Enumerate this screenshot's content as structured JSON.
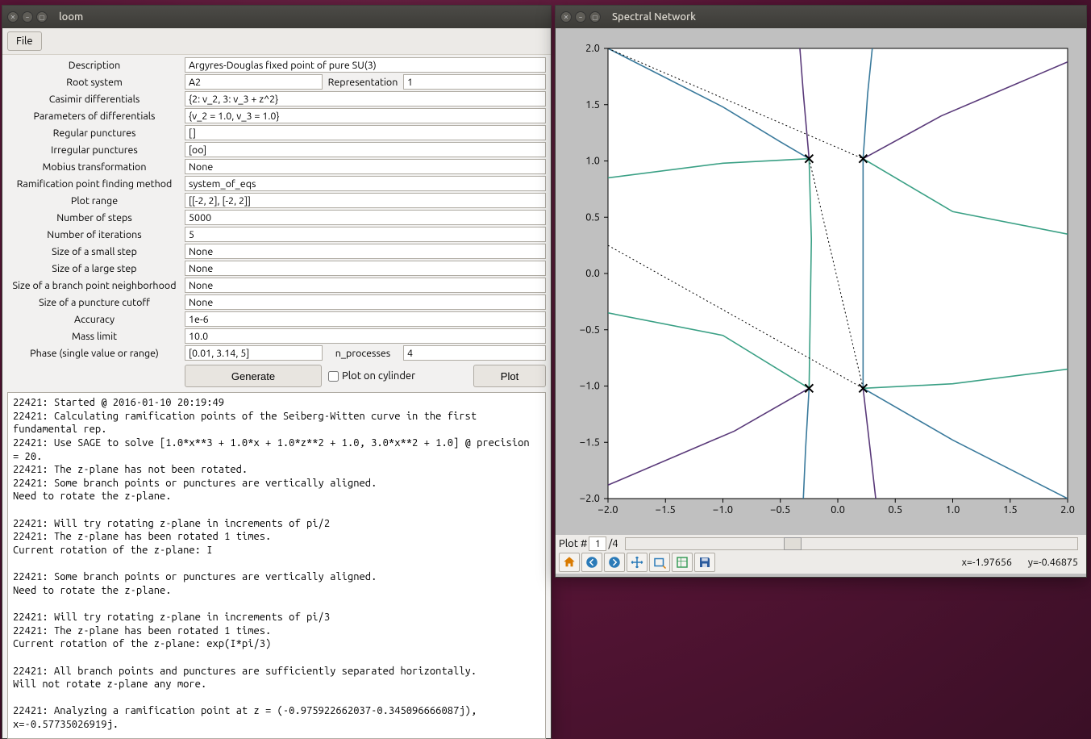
{
  "loom": {
    "title": "loom",
    "menu_file": "File",
    "labels": {
      "description": "Description",
      "root_system": "Root system",
      "representation": "Representation",
      "casimir": "Casimir differentials",
      "params_diff": "Parameters of differentials",
      "regular_punc": "Regular punctures",
      "irregular_punc": "Irregular punctures",
      "mobius": "Mobius transformation",
      "ram_method": "Ramification point finding method",
      "plot_range": "Plot range",
      "num_steps": "Number of steps",
      "num_iter": "Number of iterations",
      "small_step": "Size of a small step",
      "large_step": "Size of a large step",
      "branch_nb": "Size of a branch point neighborhood",
      "punc_cutoff": "Size of a puncture cutoff",
      "accuracy": "Accuracy",
      "mass_limit": "Mass limit",
      "phase": "Phase (single value or range)",
      "n_processes": "n_processes"
    },
    "values": {
      "description": "Argyres-Douglas fixed point of pure SU(3)",
      "root_system": "A2",
      "representation": "1",
      "casimir": "{2: v_2, 3: v_3 + z^2}",
      "params_diff": "{v_2 = 1.0, v_3 = 1.0}",
      "regular_punc": "[]",
      "irregular_punc": "[oo]",
      "mobius": "None",
      "ram_method": "system_of_eqs",
      "plot_range": "[[-2, 2], [-2, 2]]",
      "num_steps": "5000",
      "num_iter": "5",
      "small_step": "None",
      "large_step": "None",
      "branch_nb": "None",
      "punc_cutoff": "None",
      "accuracy": "1e-6",
      "mass_limit": "10.0",
      "phase": "[0.01, 3.14, 5]",
      "n_processes": "4"
    },
    "buttons": {
      "generate": "Generate",
      "plot_cyl": "Plot on cylinder",
      "plot": "Plot"
    },
    "log": "22421: Started @ 2016-01-10 20:19:49\n22421: Calculating ramification points of the Seiberg-Witten curve in the first fundamental rep.\n22421: Use SAGE to solve [1.0*x**3 + 1.0*x + 1.0*z**2 + 1.0, 3.0*x**2 + 1.0] @ precision = 20.\n22421: The z-plane has not been rotated.\n22421: Some branch points or punctures are vertically aligned.\nNeed to rotate the z-plane.\n\n22421: Will try rotating z-plane in increments of pi/2\n22421: The z-plane has been rotated 1 times.\nCurrent rotation of the z-plane: I\n\n22421: Some branch points or punctures are vertically aligned.\nNeed to rotate the z-plane.\n\n22421: Will try rotating z-plane in increments of pi/3\n22421: The z-plane has been rotated 1 times.\nCurrent rotation of the z-plane: exp(I*pi/3)\n\n22421: All branch points and punctures are sufficiently separated horizontally.\nWill not rotate z-plane any more.\n\n22421: Analyzing a ramification point at z = (-0.975922662037-0.345096666087j), x=-0.57735026919j."
  },
  "spectral": {
    "title": "Spectral Network",
    "plot_num_label": "Plot #",
    "plot_num": "1",
    "plot_total": "/4",
    "coords_x": "x=-1.97656",
    "coords_y": "y=-0.46875"
  },
  "chart_data": {
    "type": "line",
    "title": "",
    "xlabel": "",
    "ylabel": "",
    "xlim": [
      -2,
      2
    ],
    "ylim": [
      -2,
      2
    ],
    "xticks": [
      -2.0,
      -1.5,
      -1.0,
      -0.5,
      0.0,
      0.5,
      1.0,
      1.5,
      2.0
    ],
    "yticks": [
      -2.0,
      -1.5,
      -1.0,
      -0.5,
      0.0,
      0.5,
      1.0,
      1.5,
      2.0
    ],
    "xticklabels": [
      "−2.0",
      "−1.5",
      "−1.0",
      "−0.5",
      "0.0",
      "0.5",
      "1.0",
      "1.5",
      "2.0"
    ],
    "yticklabels": [
      "−2.0",
      "−1.5",
      "−1.0",
      "−0.5",
      "0.0",
      "0.5",
      "1.0",
      "1.5",
      "2.0"
    ],
    "markers": [
      {
        "x": -0.25,
        "y": 1.02,
        "symbol": "x"
      },
      {
        "x": 0.22,
        "y": 1.02,
        "symbol": "x"
      },
      {
        "x": -0.25,
        "y": -1.02,
        "symbol": "x"
      },
      {
        "x": 0.22,
        "y": -1.02,
        "symbol": "x"
      }
    ],
    "series": [
      {
        "name": "s1",
        "color": "#3a7a9c",
        "points": [
          [
            -2.0,
            2.0
          ],
          [
            -1.0,
            1.48
          ],
          [
            -0.5,
            1.17
          ],
          [
            -0.25,
            1.02
          ]
        ]
      },
      {
        "name": "s2",
        "color": "#5a3a7a",
        "points": [
          [
            -0.25,
            1.02
          ],
          [
            -0.3,
            1.6
          ],
          [
            -0.33,
            2.0
          ]
        ]
      },
      {
        "name": "s3",
        "color": "#3aa085",
        "points": [
          [
            -0.25,
            1.02
          ],
          [
            -0.23,
            0.3
          ],
          [
            -0.25,
            -1.02
          ]
        ]
      },
      {
        "name": "s4",
        "color": "#3a7a9c",
        "points": [
          [
            0.22,
            1.02
          ],
          [
            0.26,
            1.6
          ],
          [
            0.3,
            2.0
          ]
        ]
      },
      {
        "name": "s5",
        "color": "#5a3a7a",
        "points": [
          [
            0.22,
            1.02
          ],
          [
            0.9,
            1.4
          ],
          [
            2.0,
            1.88
          ]
        ]
      },
      {
        "name": "s6",
        "color": "#3a7a9c",
        "points": [
          [
            0.22,
            1.02
          ],
          [
            0.22,
            0.0
          ],
          [
            0.22,
            -1.02
          ]
        ]
      },
      {
        "name": "s7",
        "color": "#3aa085",
        "points": [
          [
            0.22,
            1.02
          ],
          [
            1.0,
            0.55
          ],
          [
            2.0,
            0.35
          ]
        ]
      },
      {
        "name": "s8",
        "color": "#3aa085",
        "points": [
          [
            -2.0,
            0.85
          ],
          [
            -1.0,
            0.98
          ],
          [
            -0.25,
            1.02
          ]
        ]
      },
      {
        "name": "s9",
        "color": "#5a3a7a",
        "points": [
          [
            -2.0,
            -1.88
          ],
          [
            -0.9,
            -1.4
          ],
          [
            -0.25,
            -1.02
          ]
        ]
      },
      {
        "name": "s10",
        "color": "#3a7a9c",
        "points": [
          [
            -0.25,
            -1.02
          ],
          [
            -0.28,
            -1.55
          ],
          [
            -0.3,
            -2.0
          ]
        ]
      },
      {
        "name": "s11",
        "color": "#3aa085",
        "points": [
          [
            -0.25,
            -1.02
          ],
          [
            -1.0,
            -0.55
          ],
          [
            -2.0,
            -0.35
          ]
        ]
      },
      {
        "name": "s12",
        "color": "#5a3a7a",
        "points": [
          [
            0.22,
            -1.02
          ],
          [
            0.28,
            -1.55
          ],
          [
            0.33,
            -2.0
          ]
        ]
      },
      {
        "name": "s13",
        "color": "#3a7a9c",
        "points": [
          [
            0.22,
            -1.02
          ],
          [
            1.0,
            -1.48
          ],
          [
            2.0,
            -2.0
          ]
        ]
      },
      {
        "name": "s14",
        "color": "#3aa085",
        "points": [
          [
            0.22,
            -1.02
          ],
          [
            1.0,
            -0.98
          ],
          [
            2.0,
            -0.85
          ]
        ]
      },
      {
        "name": "d1",
        "color": "#000",
        "dashed": true,
        "points": [
          [
            -2.0,
            2.0
          ],
          [
            0.22,
            1.02
          ]
        ]
      },
      {
        "name": "d2",
        "color": "#000",
        "dashed": true,
        "points": [
          [
            -2.0,
            0.25
          ],
          [
            0.22,
            -1.02
          ]
        ]
      },
      {
        "name": "d3",
        "color": "#000",
        "dashed": true,
        "points": [
          [
            -0.25,
            1.02
          ],
          [
            0.22,
            -1.02
          ]
        ]
      }
    ]
  }
}
